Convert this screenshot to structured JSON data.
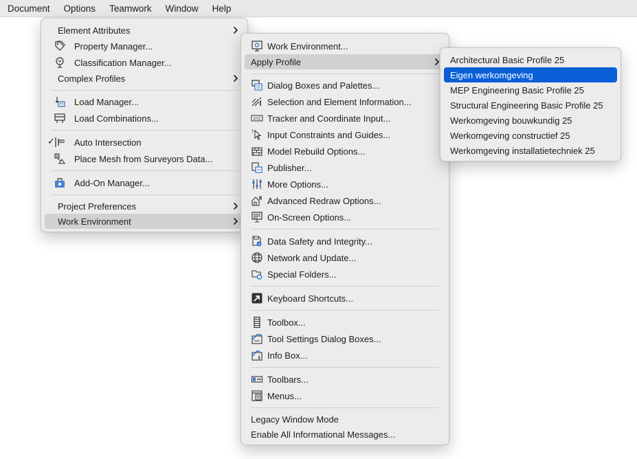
{
  "menubar": [
    "Document",
    "Options",
    "Teamwork",
    "Window",
    "Help"
  ],
  "options_menu": {
    "element_attributes": "Element Attributes",
    "property_manager": "Property Manager...",
    "classification_manager": "Classification Manager...",
    "complex_profiles": "Complex Profiles",
    "load_manager": "Load Manager...",
    "load_combinations": "Load Combinations...",
    "auto_intersection": "Auto Intersection",
    "auto_intersection_checked": "✓",
    "place_mesh": "Place Mesh from Surveyors Data...",
    "addon_manager": "Add-On Manager...",
    "project_preferences": "Project Preferences",
    "work_environment": "Work Environment"
  },
  "work_env_menu": {
    "work_environment": "Work Environment...",
    "apply_profile": "Apply Profile",
    "dialog_boxes": "Dialog Boxes and Palettes...",
    "selection_info": "Selection and Element Information...",
    "tracker": "Tracker and Coordinate Input...",
    "input_constraints": "Input Constraints and Guides...",
    "model_rebuild": "Model Rebuild Options...",
    "publisher": "Publisher...",
    "more_options": "More Options...",
    "redraw": "Advanced Redraw Options...",
    "onscreen": "On-Screen Options...",
    "data_safety": "Data Safety and Integrity...",
    "network": "Network and Update...",
    "special_folders": "Special Folders...",
    "keyboard": "Keyboard Shortcuts...",
    "toolbox": "Toolbox...",
    "tool_settings": "Tool Settings Dialog Boxes...",
    "info_box": "Info Box...",
    "toolbars": "Toolbars...",
    "menus": "Menus...",
    "legacy": "Legacy Window Mode",
    "enable_messages": "Enable All Informational Messages..."
  },
  "profiles_menu": {
    "items": [
      "Architectural Basic Profile 25",
      "Eigen werkomgeving",
      "MEP Engineering Basic Profile 25",
      "Structural Engineering Basic Profile 25",
      "Werkomgeving bouwkundig 25",
      "Werkomgeving constructief 25",
      "Werkomgeving installatietechniek 25"
    ],
    "selected_index": 1
  },
  "colors": {
    "selection": "#0a5fd8",
    "hover": "#d1d1d1",
    "menu_bg": "#ececec",
    "icon_blue": "#2f6fc9"
  }
}
